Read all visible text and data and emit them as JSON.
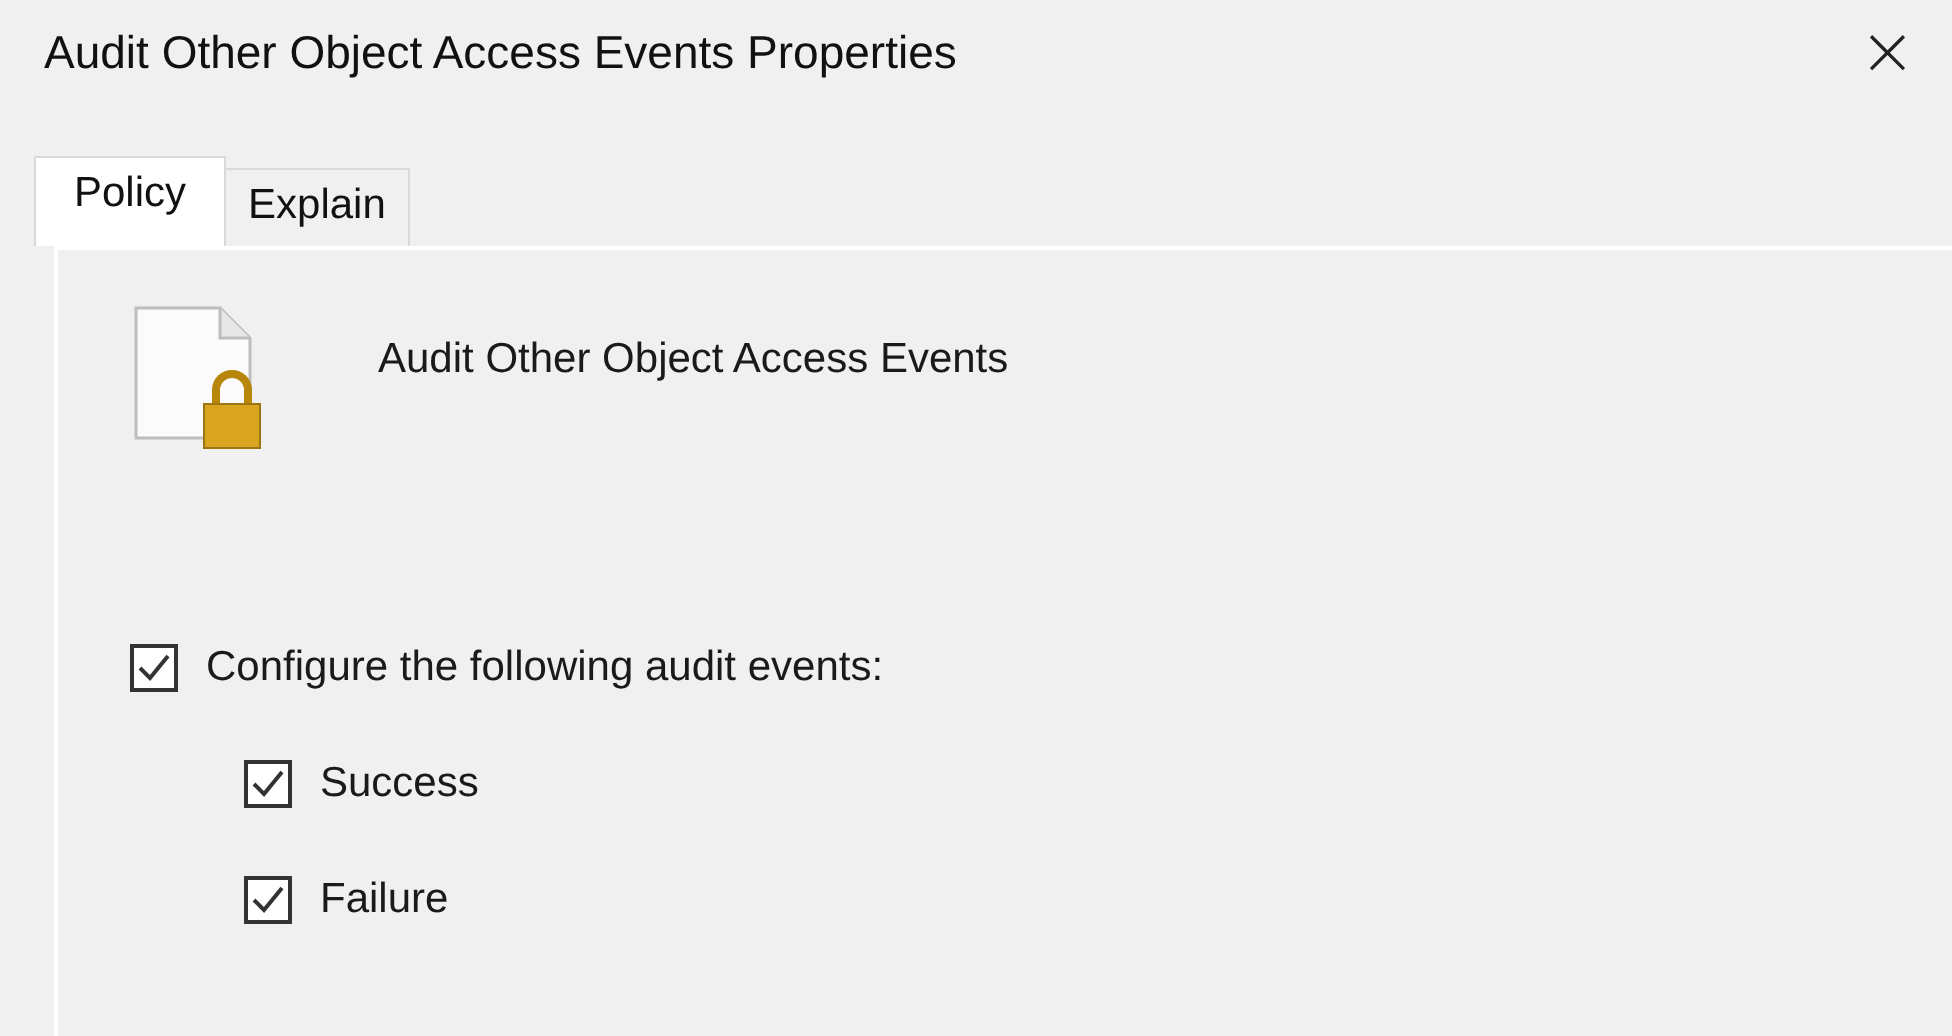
{
  "window": {
    "title": "Audit Other Object Access Events Properties",
    "close": "×"
  },
  "tabs": [
    {
      "label": "Policy",
      "selected": true
    },
    {
      "label": "Explain",
      "selected": false
    }
  ],
  "policy": {
    "name": "Audit Other Object Access Events"
  },
  "configure": {
    "label": "Configure the following audit events:",
    "checked": true
  },
  "options": [
    {
      "label": "Success",
      "checked": true
    },
    {
      "label": "Failure",
      "checked": true
    }
  ]
}
